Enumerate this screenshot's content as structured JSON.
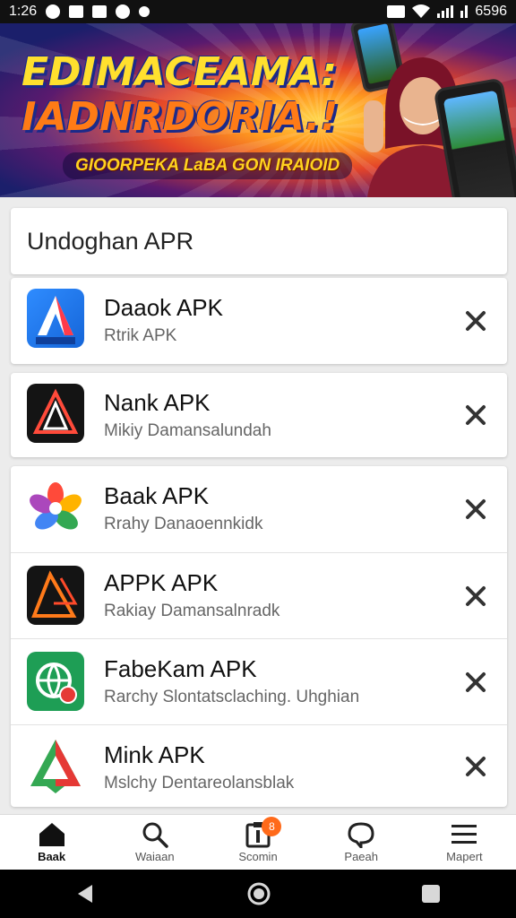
{
  "status_bar": {
    "time": "1:26",
    "right_text": "6596"
  },
  "banner": {
    "title_line1": "EDIMACEAMA:",
    "title_line2": "IADNRDORIA.!",
    "subtitle": "GIOORPEKA LaBA GON IRAIOID"
  },
  "list": {
    "header": "Undoghan APR",
    "apps": [
      {
        "name": "Daaok APK",
        "desc": "Rtrik APK",
        "icon": "blue-a-logo-icon"
      },
      {
        "name": "Nank APK",
        "desc": "Mikiy Damansalundah",
        "icon": "dark-red-triangle-logo-icon"
      },
      {
        "name": "Baak APK",
        "desc": "Rrahy Danaoennkidk",
        "icon": "colorful-flower-logo-icon"
      },
      {
        "name": "APPK APK",
        "desc": "Rakiay Damansalnradk",
        "icon": "dark-orange-triangle-logo-icon"
      },
      {
        "name": "FabeKam APK",
        "desc": "Rarchy Slontatsclaching. Uhghian",
        "icon": "green-globe-logo-icon"
      },
      {
        "name": "Mink APK",
        "desc": "Mslchy Dentareolansblak",
        "icon": "green-red-triangle-logo-icon"
      }
    ]
  },
  "bottom_nav": {
    "items": [
      {
        "label": "Baak",
        "icon": "home-icon"
      },
      {
        "label": "Waiaan",
        "icon": "search-icon"
      },
      {
        "label": "Scomin",
        "icon": "clipboard-icon",
        "badge": "8"
      },
      {
        "label": "Paeah",
        "icon": "chat-bubble-icon"
      },
      {
        "label": "Mapert",
        "icon": "menu-icon"
      }
    ]
  },
  "colors": {
    "accent_badge": "#ff6a1a",
    "card_bg": "#ffffff",
    "page_bg": "#ececec"
  }
}
